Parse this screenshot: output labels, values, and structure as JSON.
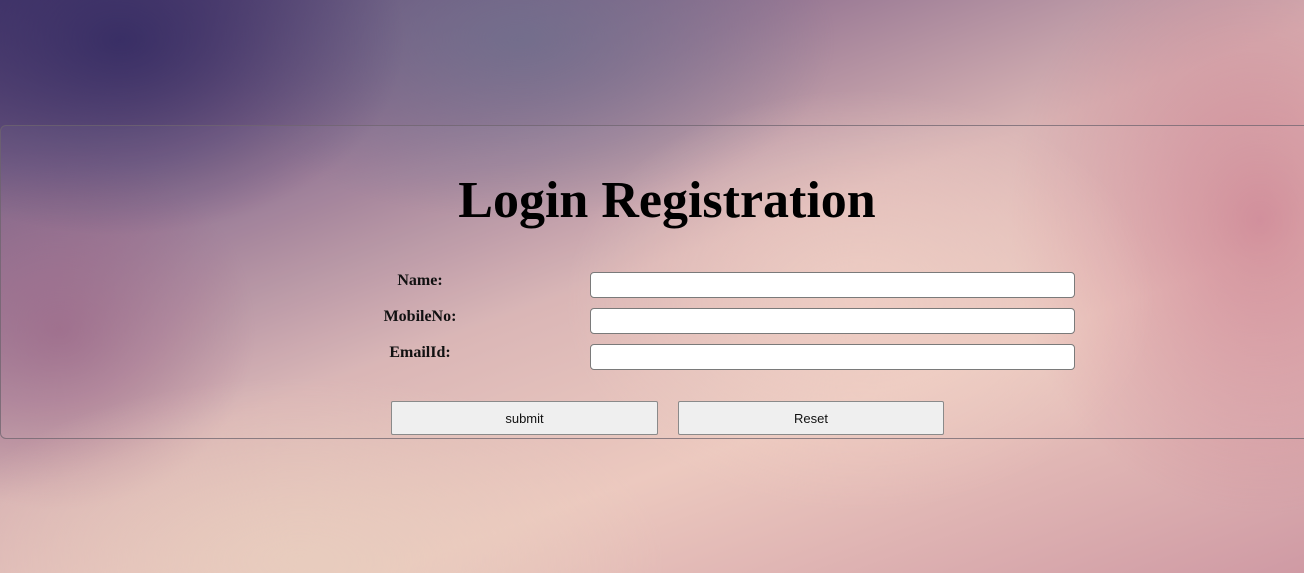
{
  "form": {
    "title": "Login Registration",
    "fields": [
      {
        "label": "Name:",
        "value": "",
        "placeholder": ""
      },
      {
        "label": "MobileNo:",
        "value": "",
        "placeholder": ""
      },
      {
        "label": "EmailId:",
        "value": "",
        "placeholder": ""
      }
    ],
    "submit_label": "submit",
    "reset_label": "Reset"
  }
}
